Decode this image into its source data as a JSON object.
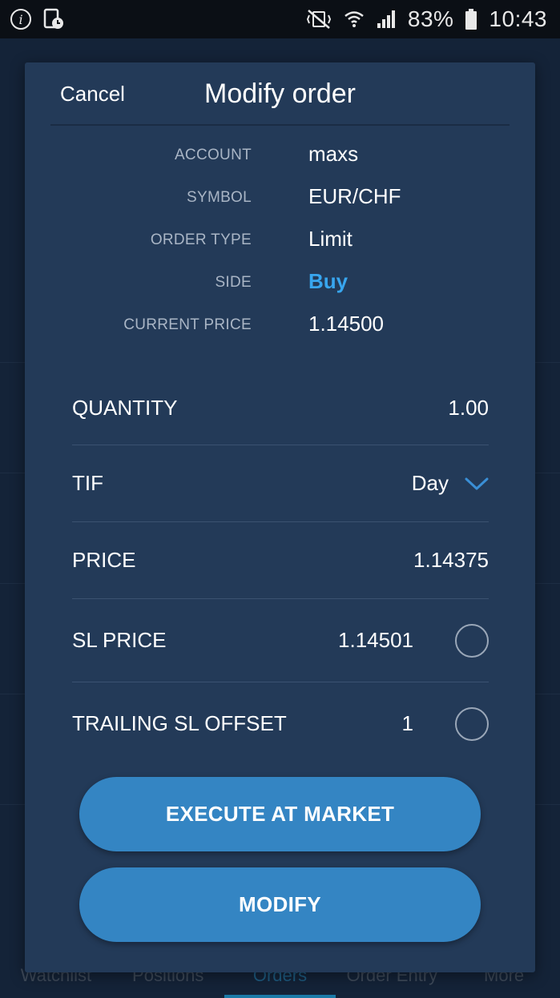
{
  "status_bar": {
    "info_icon": "info-icon",
    "screen_time_icon": "phone-clock-icon",
    "mute_icon": "vibrate-mute-icon",
    "wifi_icon": "wifi-icon",
    "signal_icon": "signal-icon",
    "battery_percent": "83%",
    "battery_icon": "battery-icon",
    "time": "10:43"
  },
  "bottom_nav": {
    "tabs": [
      {
        "label": "Watchlist",
        "active": false
      },
      {
        "label": "Positions",
        "active": false
      },
      {
        "label": "Orders",
        "active": true
      },
      {
        "label": "Order Entry",
        "active": false
      },
      {
        "label": "More",
        "active": false
      }
    ]
  },
  "modal": {
    "cancel_label": "Cancel",
    "title": "Modify order",
    "info": {
      "account_label": "ACCOUNT",
      "account_value": "maxs",
      "symbol_label": "SYMBOL",
      "symbol_value": "EUR/CHF",
      "order_type_label": "ORDER TYPE",
      "order_type_value": "Limit",
      "side_label": "SIDE",
      "side_value": "Buy",
      "current_price_label": "CURRENT PRICE",
      "current_price_value": "1.14500"
    },
    "fields": {
      "quantity_label": "QUANTITY",
      "quantity_value": "1.00",
      "tif_label": "TIF",
      "tif_value": "Day",
      "price_label": "PRICE",
      "price_value": "1.14375",
      "sl_price_label": "SL PRICE",
      "sl_price_value": "1.14501",
      "trailing_sl_label": "TRAILING SL OFFSET",
      "trailing_sl_value": "1"
    },
    "execute_label": "EXECUTE AT MARKET",
    "modify_label": "MODIFY"
  },
  "colors": {
    "modal_bg": "#233a58",
    "accent_blue": "#3485c3",
    "buy_blue": "#38a6ef"
  }
}
